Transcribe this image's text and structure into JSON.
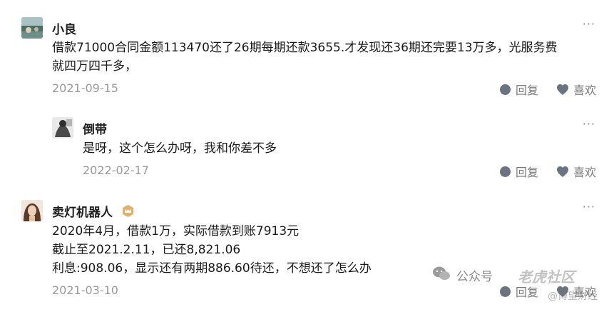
{
  "comments": [
    {
      "name": "小良",
      "lines": [
        "借款71000合同金额113470还了26期每期还款3655.才发现还36期还完要13万多，光服务费",
        "就四万四千多，"
      ],
      "date": "2021-09-15",
      "more": "···",
      "reply_label": "回复",
      "like_label": "喜欢"
    },
    {
      "name": "倒带",
      "lines": [
        "是呀，这个怎么办呀，我和你差不多"
      ],
      "date": "2022-02-17",
      "more": "···",
      "reply_label": "回复",
      "like_label": "喜欢"
    },
    {
      "name": "卖灯机器人",
      "lines": [
        "2020年4月，借款1万，实际借款到账7913元",
        "截止至2021.2.11，已还8,821.06",
        "利息:908.06，显示还有两期886.60待还，不想还了怎么办"
      ],
      "date": "2021-03-10",
      "more": "···",
      "reply_label": "回复",
      "like_label": "喜欢"
    }
  ],
  "watermark": {
    "channel": "公众号",
    "brand": "老虎社区",
    "sub": "@博望财经"
  },
  "colors": {
    "text": "#1a1a1a",
    "meta": "#9a9a9a",
    "action": "#7a7a7a",
    "badge": "#d9a35b"
  }
}
